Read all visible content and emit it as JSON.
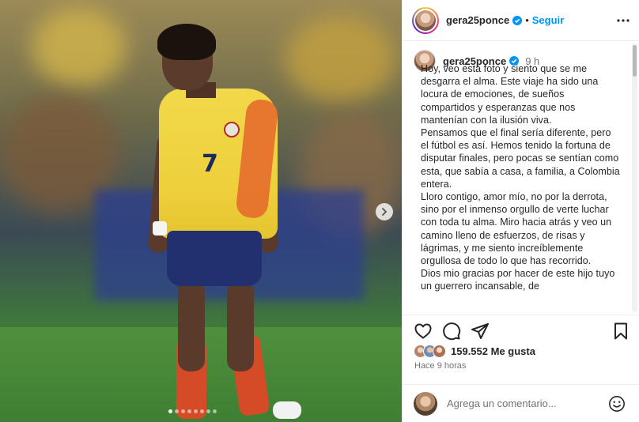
{
  "post": {
    "image": {
      "jersey_number": "7",
      "carousel_dots": 8,
      "active_dot": 0
    }
  },
  "header": {
    "username": "gera25ponce",
    "follow_label": "Seguir"
  },
  "caption": {
    "username": "gera25ponce",
    "time": "9 h",
    "paragraphs": [
      "Hoy, veo esta foto y siento que se me desgarra el alma. Este viaje ha sido una locura de emociones, de sueños compartidos y esperanzas que nos mantenían con la ilusión viva.",
      "Pensamos que el final sería diferente, pero el fútbol es así. Hemos tenido la fortuna de disputar finales, pero pocas se sentían como esta, que sabía a casa, a familia, a Colombia entera.",
      "Lloro contigo, amor mío, no por la derrota, sino por el inmenso orgullo de verte luchar con toda tu alma. Miro hacia atrás y veo un camino lleno de esfuerzos, de risas y lágrimas, y me siento increíblemente orgullosa de todo lo que has recorrido.",
      "Dios mio gracias por hacer de este hijo tuyo un guerrero incansable, de"
    ]
  },
  "engagement": {
    "likes_count": "159.552",
    "likes_label": "Me gusta",
    "time_ago": "Hace 9 horas"
  },
  "comment": {
    "placeholder": "Agrega un comentario..."
  },
  "colors": {
    "accent": "#0095f6",
    "verified": "#0095f6",
    "muted": "#737373"
  }
}
